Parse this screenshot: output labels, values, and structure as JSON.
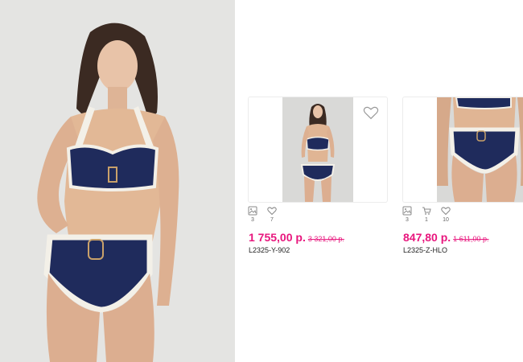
{
  "accent_color": "#e8167d",
  "products": [
    {
      "price": "1 755,00 р.",
      "old_price": "3 321,00 р.",
      "sku": "L2325-Y-902",
      "stats": [
        {
          "icon": "image-icon",
          "count": "3"
        },
        {
          "icon": "heart-icon",
          "count": "7"
        }
      ]
    },
    {
      "price": "847,80 р.",
      "old_price": "1 611,00 р.",
      "sku": "L2325-Z-HLO",
      "stats": [
        {
          "icon": "image-icon",
          "count": "3"
        },
        {
          "icon": "cart-icon",
          "count": "1"
        },
        {
          "icon": "heart-icon",
          "count": "10"
        }
      ]
    }
  ]
}
